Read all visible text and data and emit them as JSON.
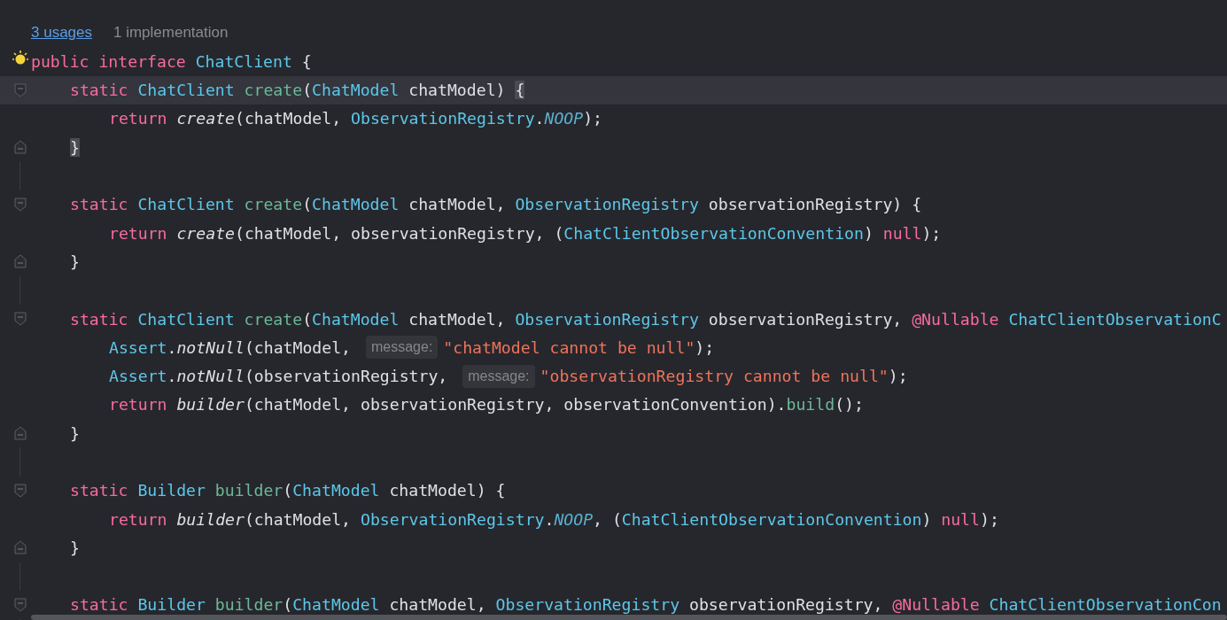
{
  "code_lens": {
    "usages": "3 usages",
    "implementations": "1 implementation"
  },
  "lines": [
    {
      "kind": "code",
      "fold_start": false,
      "fold_end": false,
      "current": false,
      "tokens": [
        {
          "t": "public ",
          "kind": "keyword"
        },
        {
          "t": "interface ",
          "kind": "keyword"
        },
        {
          "t": "ChatClient",
          "kind": "type"
        },
        {
          "t": " {",
          "kind": "plain"
        }
      ],
      "children": [
        {
          "kind": "code",
          "fold_start": true,
          "fold_end": false,
          "current": true,
          "tokens": [
            {
              "t": "static ",
              "kind": "keyword"
            },
            {
              "t": "ChatClient ",
              "kind": "type"
            },
            {
              "t": "create",
              "kind": "decl"
            },
            {
              "t": "(",
              "kind": "plain"
            },
            {
              "t": "ChatModel",
              "kind": "type"
            },
            {
              "t": " chatModel) ",
              "kind": "plain"
            },
            {
              "t": "{",
              "kind": "match"
            }
          ],
          "children": [
            {
              "kind": "code",
              "fold_start": false,
              "fold_end": false,
              "current": false,
              "tokens": [
                {
                  "t": "return ",
                  "kind": "keyword"
                },
                {
                  "t": "create",
                  "kind": "call"
                },
                {
                  "t": "(chatModel, ",
                  "kind": "plain"
                },
                {
                  "t": "ObservationRegistry",
                  "kind": "type"
                },
                {
                  "t": ".",
                  "kind": "plain"
                },
                {
                  "t": "NOOP",
                  "kind": "constant"
                },
                {
                  "t": ");",
                  "kind": "plain"
                }
              ]
            }
          ]
        },
        {
          "kind": "code",
          "fold_start": false,
          "fold_end": true,
          "current": false,
          "tokens": [
            {
              "t": "}",
              "kind": "match"
            }
          ]
        },
        {
          "kind": "blank"
        },
        {
          "kind": "code",
          "fold_start": true,
          "fold_end": false,
          "current": false,
          "tokens": [
            {
              "t": "static ",
              "kind": "keyword"
            },
            {
              "t": "ChatClient ",
              "kind": "type"
            },
            {
              "t": "create",
              "kind": "decl"
            },
            {
              "t": "(",
              "kind": "plain"
            },
            {
              "t": "ChatModel",
              "kind": "type"
            },
            {
              "t": " chatModel, ",
              "kind": "plain"
            },
            {
              "t": "ObservationRegistry",
              "kind": "type"
            },
            {
              "t": " observationRegistry) {",
              "kind": "plain"
            }
          ],
          "children": [
            {
              "kind": "code",
              "fold_start": false,
              "fold_end": false,
              "current": false,
              "tokens": [
                {
                  "t": "return ",
                  "kind": "keyword"
                },
                {
                  "t": "create",
                  "kind": "call"
                },
                {
                  "t": "(chatModel, observationRegistry, (",
                  "kind": "plain"
                },
                {
                  "t": "ChatClientObservationConvention",
                  "kind": "type"
                },
                {
                  "t": ") ",
                  "kind": "plain"
                },
                {
                  "t": "null",
                  "kind": "keyword"
                },
                {
                  "t": ");",
                  "kind": "plain"
                }
              ]
            }
          ]
        },
        {
          "kind": "code",
          "fold_start": false,
          "fold_end": true,
          "current": false,
          "tokens": [
            {
              "t": "}",
              "kind": "plain"
            }
          ]
        },
        {
          "kind": "blank"
        },
        {
          "kind": "code",
          "fold_start": true,
          "fold_end": false,
          "current": false,
          "tokens": [
            {
              "t": "static ",
              "kind": "keyword"
            },
            {
              "t": "ChatClient ",
              "kind": "type"
            },
            {
              "t": "create",
              "kind": "decl"
            },
            {
              "t": "(",
              "kind": "plain"
            },
            {
              "t": "ChatModel",
              "kind": "type"
            },
            {
              "t": " chatModel, ",
              "kind": "plain"
            },
            {
              "t": "ObservationRegistry",
              "kind": "type"
            },
            {
              "t": " observationRegistry, ",
              "kind": "plain"
            },
            {
              "t": "@Nullable ",
              "kind": "keyword"
            },
            {
              "t": "ChatClientObservationC",
              "kind": "type"
            }
          ],
          "children": [
            {
              "kind": "code",
              "fold_start": false,
              "fold_end": false,
              "current": false,
              "tokens": [
                {
                  "t": "Assert",
                  "kind": "type"
                },
                {
                  "t": ".",
                  "kind": "plain"
                },
                {
                  "t": "notNull",
                  "kind": "call"
                },
                {
                  "t": "(chatModel, ",
                  "kind": "plain"
                },
                {
                  "t": "message:",
                  "kind": "hint"
                },
                {
                  "t": "\"chatModel cannot be null\"",
                  "kind": "string"
                },
                {
                  "t": ");",
                  "kind": "plain"
                }
              ]
            },
            {
              "kind": "code",
              "fold_start": false,
              "fold_end": false,
              "current": false,
              "tokens": [
                {
                  "t": "Assert",
                  "kind": "type"
                },
                {
                  "t": ".",
                  "kind": "plain"
                },
                {
                  "t": "notNull",
                  "kind": "call"
                },
                {
                  "t": "(observationRegistry, ",
                  "kind": "plain"
                },
                {
                  "t": "message:",
                  "kind": "hint"
                },
                {
                  "t": "\"observationRegistry cannot be null\"",
                  "kind": "string"
                },
                {
                  "t": ");",
                  "kind": "plain"
                }
              ]
            },
            {
              "kind": "code",
              "fold_start": false,
              "fold_end": false,
              "current": false,
              "tokens": [
                {
                  "t": "return ",
                  "kind": "keyword"
                },
                {
                  "t": "builder",
                  "kind": "call"
                },
                {
                  "t": "(chatModel, observationRegistry, observationConvention).",
                  "kind": "plain"
                },
                {
                  "t": "build",
                  "kind": "decl"
                },
                {
                  "t": "();",
                  "kind": "plain"
                }
              ]
            }
          ]
        },
        {
          "kind": "code",
          "fold_start": false,
          "fold_end": true,
          "current": false,
          "tokens": [
            {
              "t": "}",
              "kind": "plain"
            }
          ]
        },
        {
          "kind": "blank"
        },
        {
          "kind": "code",
          "fold_start": true,
          "fold_end": false,
          "current": false,
          "tokens": [
            {
              "t": "static ",
              "kind": "keyword"
            },
            {
              "t": "Builder ",
              "kind": "type"
            },
            {
              "t": "builder",
              "kind": "decl"
            },
            {
              "t": "(",
              "kind": "plain"
            },
            {
              "t": "ChatModel",
              "kind": "type"
            },
            {
              "t": " chatModel) {",
              "kind": "plain"
            }
          ],
          "children": [
            {
              "kind": "code",
              "fold_start": false,
              "fold_end": false,
              "current": false,
              "tokens": [
                {
                  "t": "return ",
                  "kind": "keyword"
                },
                {
                  "t": "builder",
                  "kind": "call"
                },
                {
                  "t": "(chatModel, ",
                  "kind": "plain"
                },
                {
                  "t": "ObservationRegistry",
                  "kind": "type"
                },
                {
                  "t": ".",
                  "kind": "plain"
                },
                {
                  "t": "NOOP",
                  "kind": "constant"
                },
                {
                  "t": ", (",
                  "kind": "plain"
                },
                {
                  "t": "ChatClientObservationConvention",
                  "kind": "type"
                },
                {
                  "t": ") ",
                  "kind": "plain"
                },
                {
                  "t": "null",
                  "kind": "keyword"
                },
                {
                  "t": ");",
                  "kind": "plain"
                }
              ]
            }
          ]
        },
        {
          "kind": "code",
          "fold_start": false,
          "fold_end": true,
          "current": false,
          "tokens": [
            {
              "t": "}",
              "kind": "plain"
            }
          ]
        },
        {
          "kind": "blank"
        },
        {
          "kind": "code",
          "fold_start": true,
          "fold_end": false,
          "current": false,
          "tokens": [
            {
              "t": "static ",
              "kind": "keyword"
            },
            {
              "t": "Builder ",
              "kind": "type"
            },
            {
              "t": "builder",
              "kind": "decl"
            },
            {
              "t": "(",
              "kind": "plain"
            },
            {
              "t": "ChatModel",
              "kind": "type"
            },
            {
              "t": " chatModel, ",
              "kind": "plain"
            },
            {
              "t": "ObservationRegistry",
              "kind": "type"
            },
            {
              "t": " observationRegistry, ",
              "kind": "plain"
            },
            {
              "t": "@Nullable ",
              "kind": "keyword"
            },
            {
              "t": "ChatClientObservationCon",
              "kind": "type"
            }
          ]
        }
      ]
    }
  ]
}
